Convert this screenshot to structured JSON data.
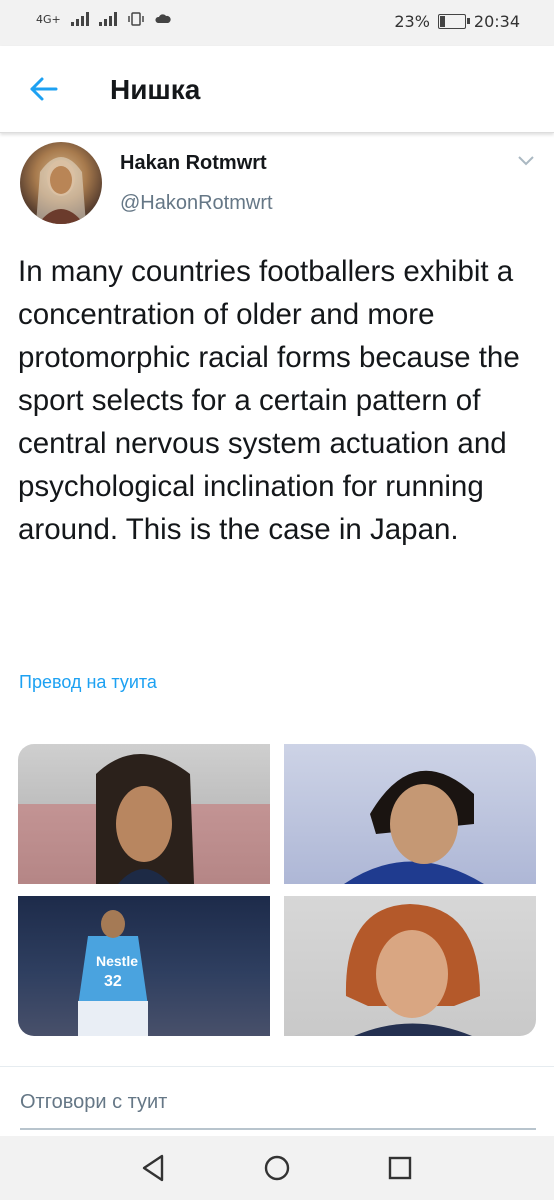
{
  "status_bar": {
    "network": "4G+",
    "battery_percent": "23%",
    "battery_level": 0.23,
    "time": "20:34"
  },
  "header": {
    "back_icon": "arrow-left-icon",
    "title": "Нишка",
    "accent_color": "#1da1f2"
  },
  "tweet": {
    "author_name": "Hakan Rotmwrt",
    "author_handle": "@HakonRotmwrt",
    "text": "In many countries footballers exhibit a concentration of older and more protomorphic racial forms because the sport selects for a certain pattern of central nervous system actuation and psychological inclination for running around. This is the case in Japan.",
    "translate_label": "Превод на туита",
    "media_count": 4,
    "jersey_text": "Nestle",
    "jersey_number": "32"
  },
  "reply": {
    "placeholder": "Отговори с туит"
  },
  "nav_icons": [
    "back-triangle-icon",
    "home-circle-icon",
    "recents-square-icon"
  ]
}
